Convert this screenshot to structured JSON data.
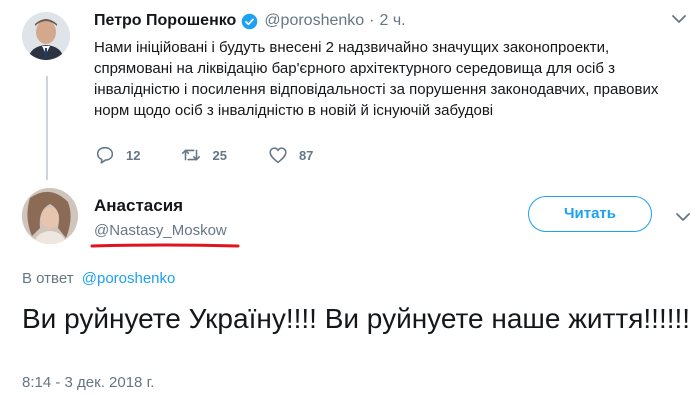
{
  "tweet1": {
    "author_name": "Петро Порошенко",
    "handle": "@poroshenko",
    "separator": "·",
    "time": "2 ч.",
    "text": "Нами ініційовані і будуть внесені 2 надзвичайно значущих законопроекти, спрямовані на ліквідацію бар'єрного архітектурного середовища для осіб з інвалідністю і посилення відповідальності за порушення законодавчих, правових норм щодо осіб з інвалідністю в новій й існуючій забудові",
    "actions": {
      "reply_count": "12",
      "retweet_count": "25",
      "like_count": "87"
    },
    "icons": [
      "verified-icon",
      "chevron-down-icon",
      "reply-icon",
      "retweet-icon",
      "like-icon"
    ]
  },
  "tweet2": {
    "author_name": "Анастасия",
    "handle": "@Nastasy_Moskow",
    "follow_label": "Читать",
    "reply_prefix": "В ответ",
    "reply_to": "@poroshenko",
    "text": "Ви руйнуете Україну!!!! Ви руйнуете наше життя!!!!!!",
    "timestamp": "8:14 - 3 дек. 2018 г."
  },
  "colors": {
    "text": "#14171a",
    "muted": "#657786",
    "accent": "#1da1f2",
    "annotation_red": "#e0141e",
    "thread_line": "#ccd6dd"
  }
}
